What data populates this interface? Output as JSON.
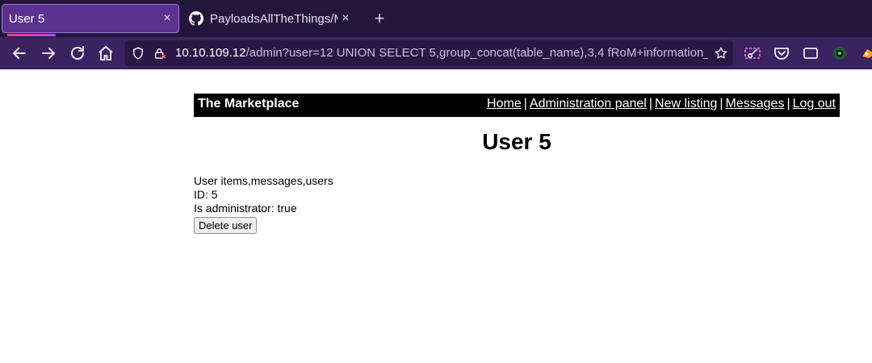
{
  "browser": {
    "tabs": [
      {
        "title": "User 5",
        "active": true
      },
      {
        "title": "PayloadsAllTheThings/My",
        "active": false
      }
    ],
    "new_tab_symbol": "+",
    "close_symbol": "×",
    "url": {
      "host": "10.10.109.12",
      "path": "/admin?user=12 UNION SELECT 5,group_concat(table_name),3,4 fRoM+information_"
    },
    "icons": [
      "back-icon",
      "forward-icon",
      "reload-icon",
      "home-icon",
      "shield-icon",
      "lock-icon",
      "bookmark-star-icon",
      "screenshot-icon",
      "pocket-icon",
      "reader-view-icon",
      "extension-icon",
      "extension-icon"
    ],
    "colors": {
      "tabbar_bg": "#24163b",
      "toolbar_bg": "#3b2260",
      "active_tab": "#5b338f"
    }
  },
  "site": {
    "name": "The Marketplace",
    "nav": [
      "Home",
      "Administration panel",
      "New listing",
      "Messages",
      "Log out"
    ],
    "nav_separator": "|"
  },
  "page": {
    "title": "User 5",
    "info": {
      "user_line": "User items,messages,users",
      "id_line": "ID: 5",
      "admin_line": "Is administrator: true"
    },
    "delete_button": "Delete user"
  }
}
